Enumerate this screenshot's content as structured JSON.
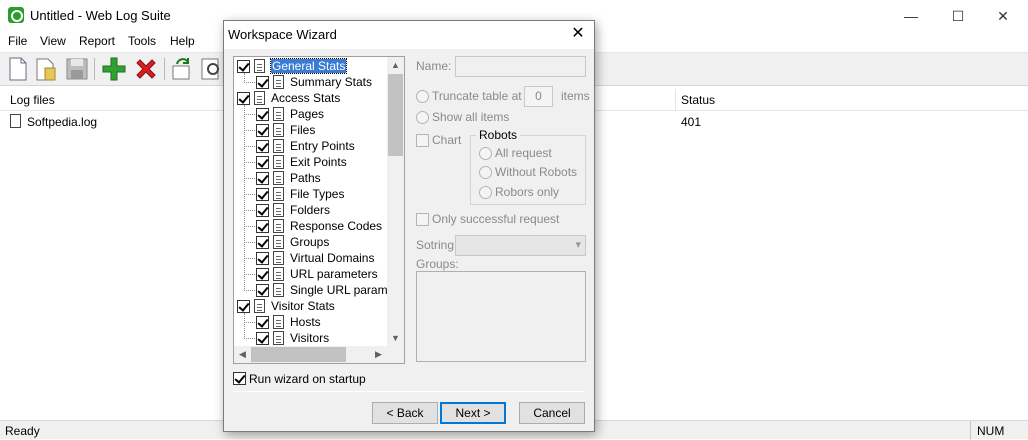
{
  "window": {
    "title": "Untitled - Web Log Suite",
    "minimize": "—",
    "maximize": "☐",
    "close": "✕"
  },
  "menu": [
    "File",
    "View",
    "Report",
    "Tools",
    "Help"
  ],
  "list": {
    "columns": [
      "Log files",
      "Status"
    ],
    "rows": [
      {
        "file": "Softpedia.log",
        "status": "401"
      }
    ]
  },
  "status": {
    "text": "Ready",
    "num": "NUM"
  },
  "dialog": {
    "title": "Workspace Wizard",
    "close": "✕",
    "tree": [
      {
        "label": "General Stats",
        "level": 0,
        "checked": true,
        "selected": true
      },
      {
        "label": "Summary Stats",
        "level": 1,
        "checked": true
      },
      {
        "label": "Access Stats",
        "level": 0,
        "checked": true
      },
      {
        "label": "Pages",
        "level": 1,
        "checked": true
      },
      {
        "label": "Files",
        "level": 1,
        "checked": true
      },
      {
        "label": "Entry Points",
        "level": 1,
        "checked": true
      },
      {
        "label": "Exit Points",
        "level": 1,
        "checked": true
      },
      {
        "label": "Paths",
        "level": 1,
        "checked": true
      },
      {
        "label": "File Types",
        "level": 1,
        "checked": true
      },
      {
        "label": "Folders",
        "level": 1,
        "checked": true
      },
      {
        "label": "Response Codes",
        "level": 1,
        "checked": true
      },
      {
        "label": "Groups",
        "level": 1,
        "checked": true
      },
      {
        "label": "Virtual Domains",
        "level": 1,
        "checked": true
      },
      {
        "label": "URL parameters",
        "level": 1,
        "checked": true
      },
      {
        "label": "Single URL paramet",
        "level": 1,
        "checked": true
      },
      {
        "label": "Visitor Stats",
        "level": 0,
        "checked": true
      },
      {
        "label": "Hosts",
        "level": 1,
        "checked": true
      },
      {
        "label": "Visitors",
        "level": 1,
        "checked": true
      }
    ],
    "name_label": "Name:",
    "name_value": "",
    "truncate_label": "Truncate table at",
    "truncate_value": "0",
    "items_label": "items",
    "show_all_label": "Show all items",
    "chart_label": "Chart",
    "robots_legend": "Robots",
    "robots_options": [
      "All request",
      "Without Robots",
      "Robors only"
    ],
    "only_successful_label": "Only successful request",
    "sorting_label": "Sotring:",
    "groups_label": "Groups:",
    "run_wizard_label": "Run wizard on startup",
    "run_wizard_checked": true,
    "buttons": {
      "back": "< Back",
      "next": "Next >",
      "cancel": "Cancel"
    }
  }
}
